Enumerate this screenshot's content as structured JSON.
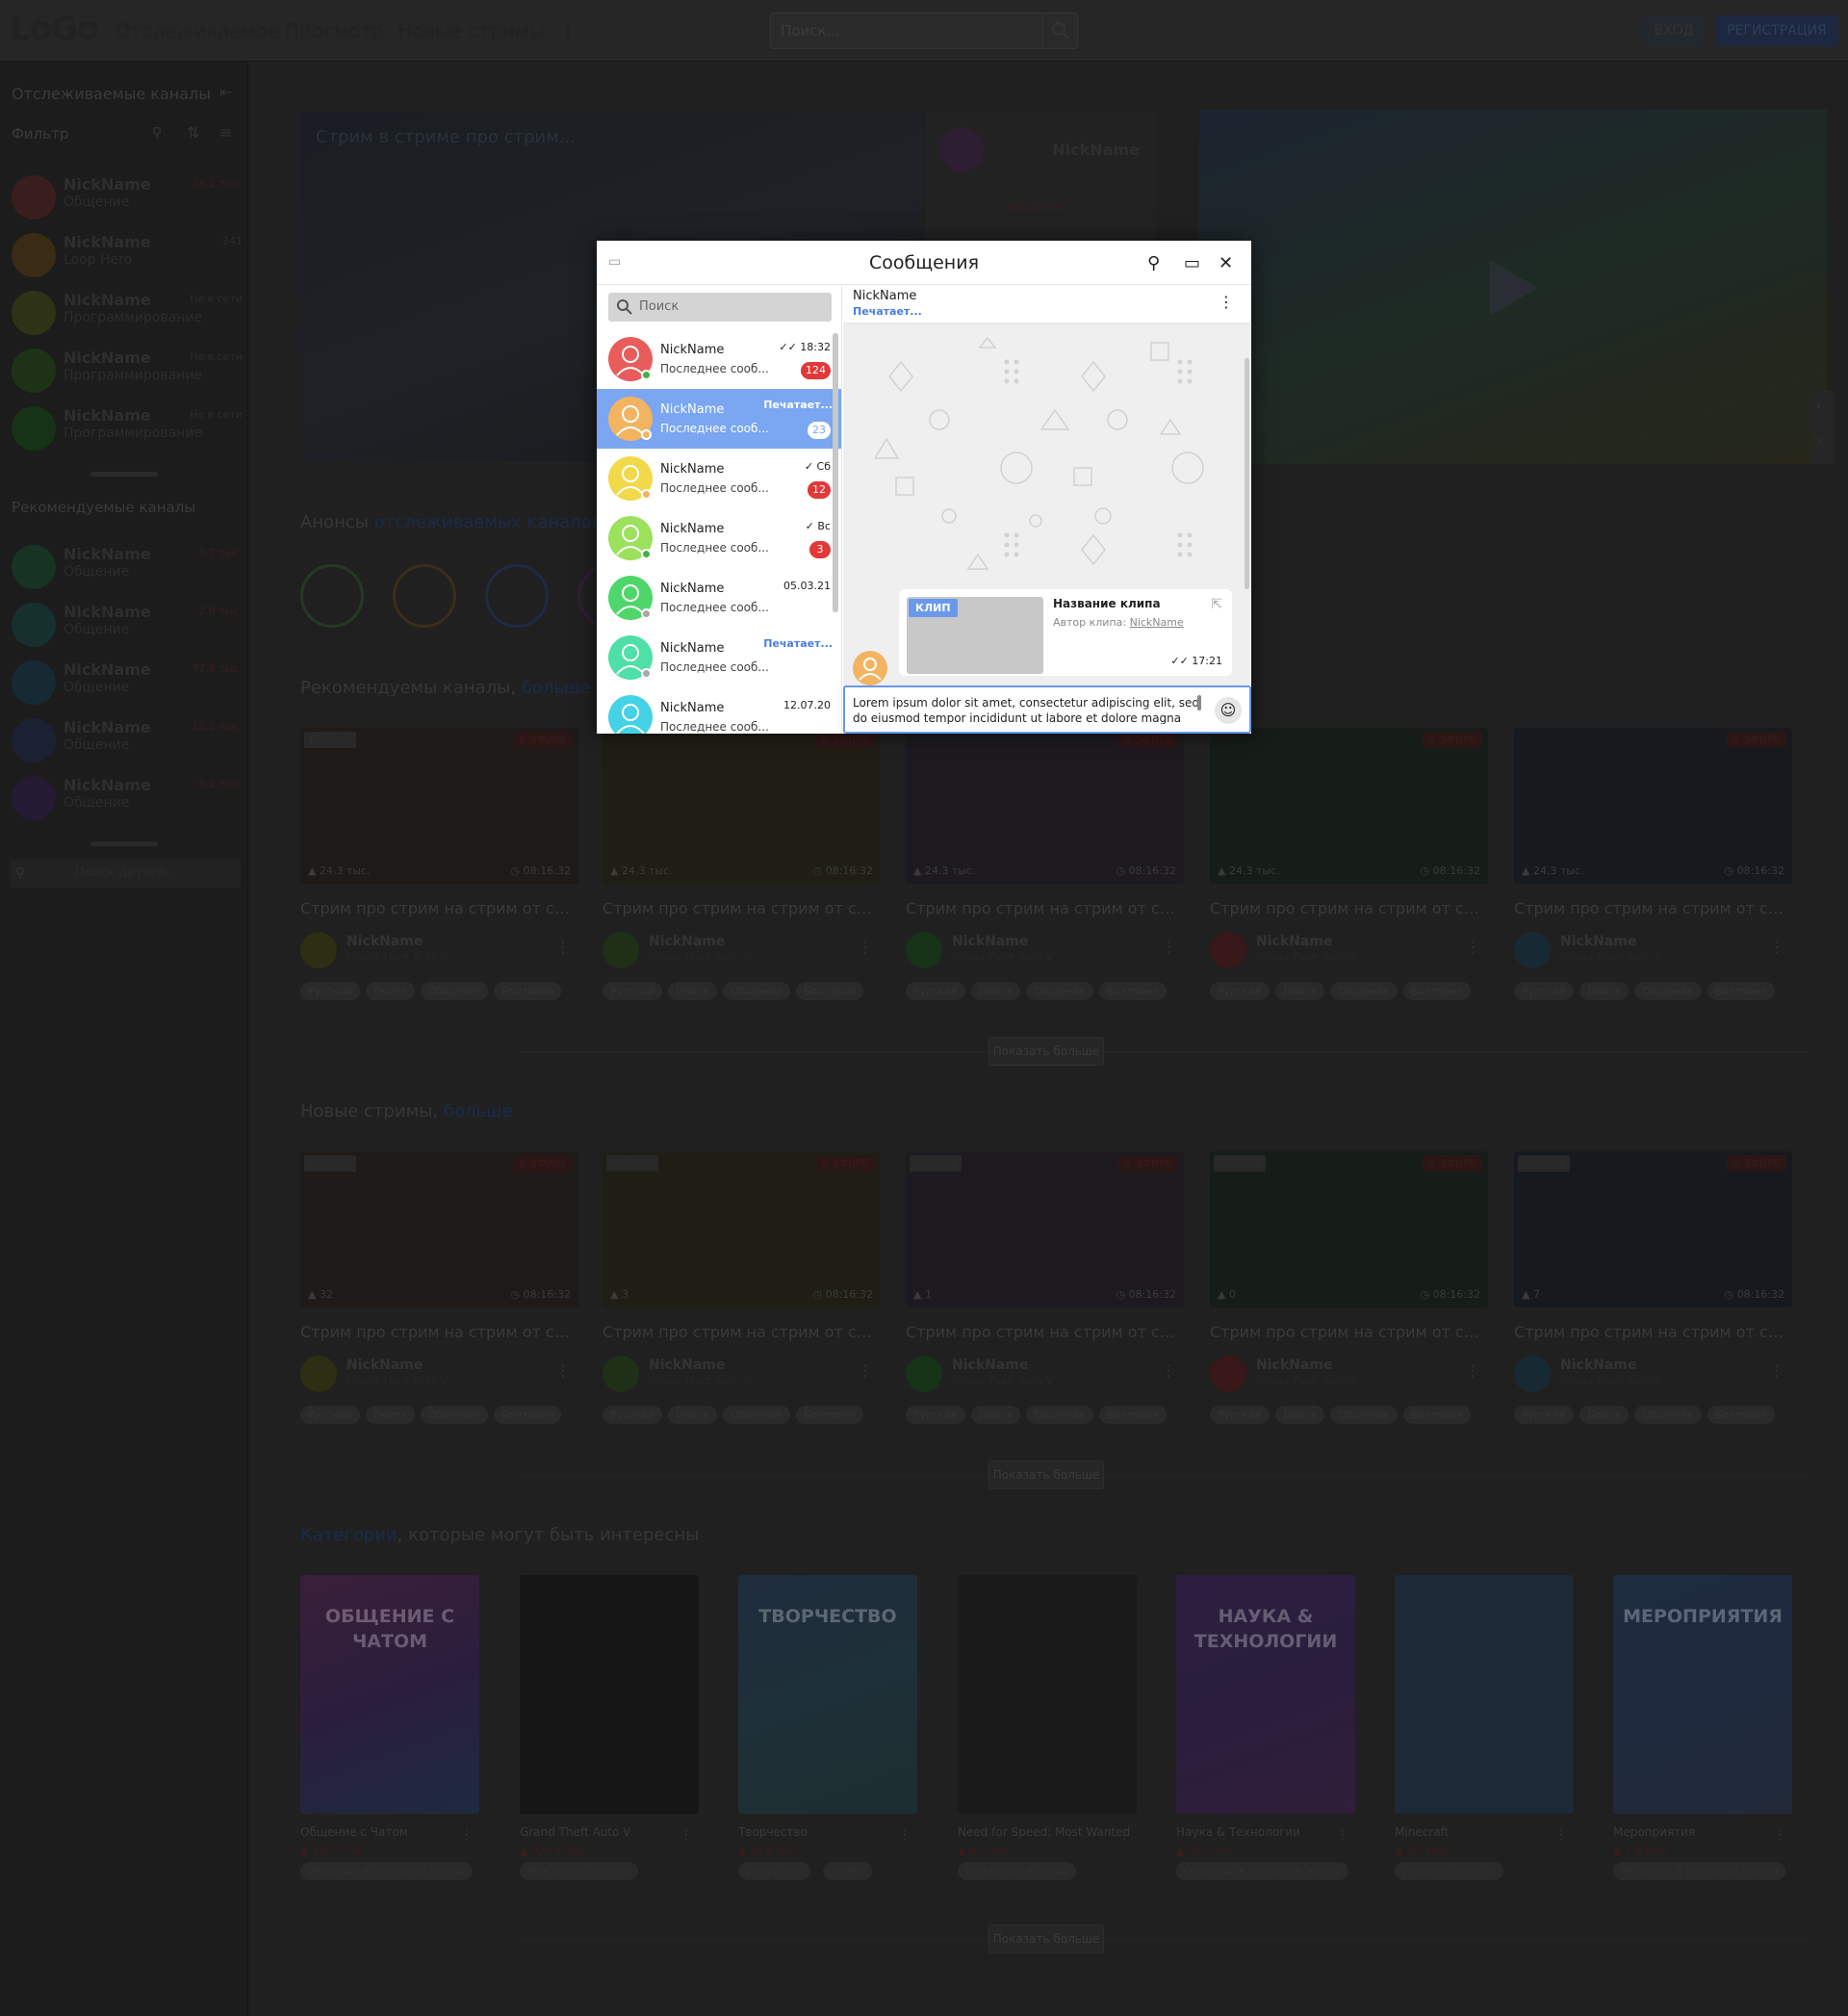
{
  "header": {
    "logo": "LoGo",
    "nav": [
      "Отслеживаемое",
      "Просмотр",
      "Новые стримы"
    ],
    "search_placeholder": "Поиск...",
    "login": "ВХОД",
    "register": "РЕГИСТРАЦИЯ"
  },
  "sidebar": {
    "followed_title": "Отслеживаемые каналы",
    "filter_label": "Фильтр",
    "followed": [
      {
        "name": "NickName",
        "game": "Общение",
        "viewers": "28.2 тыс.",
        "color": "#3a1e1e"
      },
      {
        "name": "NickName",
        "game": "Loop Hero",
        "viewers": "241",
        "color": "#3a2c14"
      },
      {
        "name": "NickName",
        "game": "Программирование",
        "viewers": "Не в сети",
        "color": "#2e3316"
      },
      {
        "name": "NickName",
        "game": "Программирование",
        "viewers": "Не в сети",
        "color": "#1e3316"
      },
      {
        "name": "NickName",
        "game": "Программирование",
        "viewers": "Не в сети",
        "color": "#163318"
      }
    ],
    "recommended_title": "Рекомендуемые каналы",
    "recommended": [
      {
        "name": "NickName",
        "game": "Общение",
        "viewers": "3.7 тыс.",
        "color": "#163324"
      },
      {
        "name": "NickName",
        "game": "Общение",
        "viewers": "2.8 тыс.",
        "color": "#16302e"
      },
      {
        "name": "NickName",
        "game": "Общение",
        "viewers": "77.9 тыс.",
        "color": "#162a33"
      },
      {
        "name": "NickName",
        "game": "Общение",
        "viewers": "12.2 тыс.",
        "color": "#1c2033"
      },
      {
        "name": "NickName",
        "game": "Общение",
        "viewers": "9.2 тыс.",
        "color": "#241a33"
      }
    ],
    "friends_search": "Поиск друзей..."
  },
  "hero": {
    "title": "Стрим в стриме про стрим...",
    "name": "NickName",
    "viewers": "425.2 тыс."
  },
  "announces": {
    "title": "Анонсы",
    "link": "отслеживаемых каналов"
  },
  "recommended_section": {
    "title": "Рекомендуемы каналы,",
    "link": "больше"
  },
  "new_section": {
    "title": "Новые стримы,",
    "link": "больше"
  },
  "categories_section": {
    "link": "Категории",
    "title": ", которые могут быть интересны"
  },
  "show_more": "Показать больше",
  "rec_cards": [
    {
      "label": "ПРОМО",
      "live": "В ЭФИРЕ",
      "viewers": "24.3 тыс.",
      "time": "08:16:32",
      "title": "Стрим про стрим на стрим от стрима",
      "name": "NickName",
      "game": "Grand Theft Auto V",
      "tags": [
        "Русский",
        "Поиск",
        "Общение",
        "Болтовня"
      ],
      "thumb": "#1e1a18",
      "avatar": "#2e2e12"
    },
    {
      "label": "",
      "live": "В ЭФИРЕ",
      "viewers": "24.3 тыс.",
      "time": "08:16:32",
      "title": "Стрим про стрим на стрим от стрима",
      "name": "NickName",
      "game": "Grand Theft Auto V",
      "tags": [
        "Русский",
        "Поиск",
        "Общение",
        "Болтовня"
      ],
      "thumb": "#1e1e14",
      "avatar": "#1f3016"
    },
    {
      "label": "",
      "live": "В ЭФИРЕ",
      "viewers": "24.3 тыс.",
      "time": "08:16:32",
      "title": "Стрим про стрим на стрим от стрима",
      "name": "NickName",
      "game": "Grand Theft Auto V",
      "tags": [
        "Русский",
        "Поиск",
        "Общение",
        "Болтовня"
      ],
      "thumb": "#1c1a1e",
      "avatar": "#163318"
    },
    {
      "label": "",
      "live": "В ЭФИРЕ",
      "viewers": "24.3 тыс.",
      "time": "08:16:32",
      "title": "Стрим про стрим на стрим от стрима",
      "name": "NickName",
      "game": "Grand Theft Auto V",
      "tags": [
        "Русский",
        "Поиск",
        "Общение",
        "Болтовня"
      ],
      "thumb": "#161c18",
      "avatar": "#381818"
    },
    {
      "label": "",
      "live": "В ЭФИРЕ",
      "viewers": "24.3 тыс.",
      "time": "08:16:32",
      "title": "Стрим про стрим на стрим от стрима",
      "name": "NickName",
      "game": "Grand Theft Auto V",
      "tags": [
        "Русский",
        "Поиск",
        "Общение",
        "Болтовня"
      ],
      "thumb": "#161a1e",
      "avatar": "#162a33"
    }
  ],
  "new_cards": [
    {
      "label": "НОВЫЙ",
      "live": "В ЭФИРЕ",
      "viewers": "32",
      "time": "08:16:32",
      "title": "Стрим про стрим на стрим от стрима",
      "name": "NickName",
      "game": "Grand Theft Auto V",
      "tags": [
        "Русский",
        "Поиск",
        "Общение",
        "Болтовня"
      ],
      "thumb": "#1e1a18",
      "avatar": "#2e2e12"
    },
    {
      "label": "НОВЫЙ",
      "live": "В ЭФИРЕ",
      "viewers": "3",
      "time": "08:16:32",
      "title": "Стрим про стрим на стрим от стрима",
      "name": "NickName",
      "game": "Grand Theft Auto V",
      "tags": [
        "Русский",
        "Поиск",
        "Общение",
        "Болтовня"
      ],
      "thumb": "#1e1e14",
      "avatar": "#1f3016"
    },
    {
      "label": "НОВЫЙ",
      "live": "В ЭФИРЕ",
      "viewers": "1",
      "time": "08:16:32",
      "title": "Стрим про стрим на стрим от стрима",
      "name": "NickName",
      "game": "Grand Theft Auto V",
      "tags": [
        "Русский",
        "Поиск",
        "Общение",
        "Болтовня"
      ],
      "thumb": "#1c1a1e",
      "avatar": "#163318"
    },
    {
      "label": "НОВЫЙ",
      "live": "В ЭФИРЕ",
      "viewers": "0",
      "time": "08:16:32",
      "title": "Стрим про стрим на стрим от стрима",
      "name": "NickName",
      "game": "Grand Theft Auto V",
      "tags": [
        "Русский",
        "Поиск",
        "Общение",
        "Болтовня"
      ],
      "thumb": "#161c18",
      "avatar": "#381818"
    },
    {
      "label": "НОВЫЙ",
      "live": "В ЭФИРЕ",
      "viewers": "7",
      "time": "08:16:32",
      "title": "Стрим про стрим на стрим от стрима",
      "name": "NickName",
      "game": "Grand Theft Auto V",
      "tags": [
        "Русский",
        "Поиск",
        "Общение",
        "Болтовня"
      ],
      "thumb": "#161a1e",
      "avatar": "#162a33"
    }
  ],
  "categories": [
    {
      "cover_text": "ОБЩЕНИЕ С ЧАТОМ",
      "name": "Общение с Чатом",
      "viewers": "340.7 тыс.",
      "tag": "Общение в реальной жизни",
      "bg": "linear-gradient(160deg,#3a1f3a,#2a1e3c,#1e2a40)"
    },
    {
      "cover_text": "",
      "name": "Grand Theft Auto V",
      "viewers": "920.4 тыс.",
      "tag": "Вождение и гонки",
      "bg": "#161616"
    },
    {
      "cover_text": "ТВОРЧЕСТВО",
      "name": "Творчество",
      "viewers": "24.9 тыс.",
      "tag": "Искусство",
      "tag2": "Хобби",
      "bg": "linear-gradient(160deg,#1e2c3c,#1e3038,#1c2e2e)"
    },
    {
      "cover_text": "",
      "name": "Need for Speed: Most Wanted",
      "viewers": "8.1 тыс.",
      "tag": "Вождение и гонки",
      "bg": "#1a1a1a"
    },
    {
      "cover_text": "НАУКА & ТЕХНОЛОГИИ",
      "name": "Наука & Технологии",
      "viewers": "92.3 тыс.",
      "tag": "Общение в реальной жизни",
      "bg": "linear-gradient(160deg,#2c1e40,#2a1e3c,#301e3a)"
    },
    {
      "cover_text": "",
      "name": "Minecraft",
      "viewers": "2.3 млн",
      "tag": "Игры песочницы",
      "bg": "#1c2a38"
    },
    {
      "cover_text": "МЕРОПРИЯТИЯ",
      "name": "Мероприятия",
      "viewers": "7.8 млн",
      "tag": "Общение в реальной жизни",
      "bg": "linear-gradient(160deg,#1e2c40,#1e2a3e,#222a3a)"
    }
  ],
  "modal": {
    "title": "Сообщения",
    "search_placeholder": "Поиск",
    "conversations": [
      {
        "name": "NickName",
        "msg": "Последнее сооб...",
        "time": "18:32",
        "badge": "124",
        "avatar": "#e85c5c",
        "status": "#3fb24a",
        "check": "✓✓"
      },
      {
        "name": "NickName",
        "msg": "Последнее сооб...",
        "time": "Печатает...",
        "badge": "23",
        "avatar": "#f2b461",
        "status": "#f2b461",
        "check": ""
      },
      {
        "name": "NickName",
        "msg": "Последнее сооб...",
        "time": "Сб",
        "badge": "12",
        "avatar": "#f2d94a",
        "status": "#f2b461",
        "check": "✓"
      },
      {
        "name": "NickName",
        "msg": "Последнее сооб...",
        "time": "Вс",
        "badge": "3",
        "avatar": "#9be15c",
        "status": "#3fb24a",
        "check": "✓"
      },
      {
        "name": "NickName",
        "msg": "Последнее сооб...",
        "time": "05.03.21",
        "badge": "",
        "avatar": "#4fd66a",
        "status": "#aaaaaa",
        "check": ""
      },
      {
        "name": "NickName",
        "msg": "Последнее сооб...",
        "time": "Печатает...",
        "badge": "",
        "avatar": "#4fdfa8",
        "status": "#aaaaaa",
        "check": ""
      },
      {
        "name": "NickName",
        "msg": "Последнее сооб...",
        "time": "12.07.20",
        "badge": "",
        "avatar": "#44d2e6",
        "status": "",
        "check": ""
      }
    ],
    "chat": {
      "name": "NickName",
      "status": "Печатает...",
      "clip_label": "КЛИП",
      "clip_title": "Название клипа",
      "clip_author_label": "Автор клипа:",
      "clip_author": "NickName",
      "clip_time": "17:21",
      "input_text": "Lorem ipsum dolor sit amet, consectetur adipiscing elit, sed do eiusmod tempor incididunt ut labore et dolore magna"
    }
  }
}
